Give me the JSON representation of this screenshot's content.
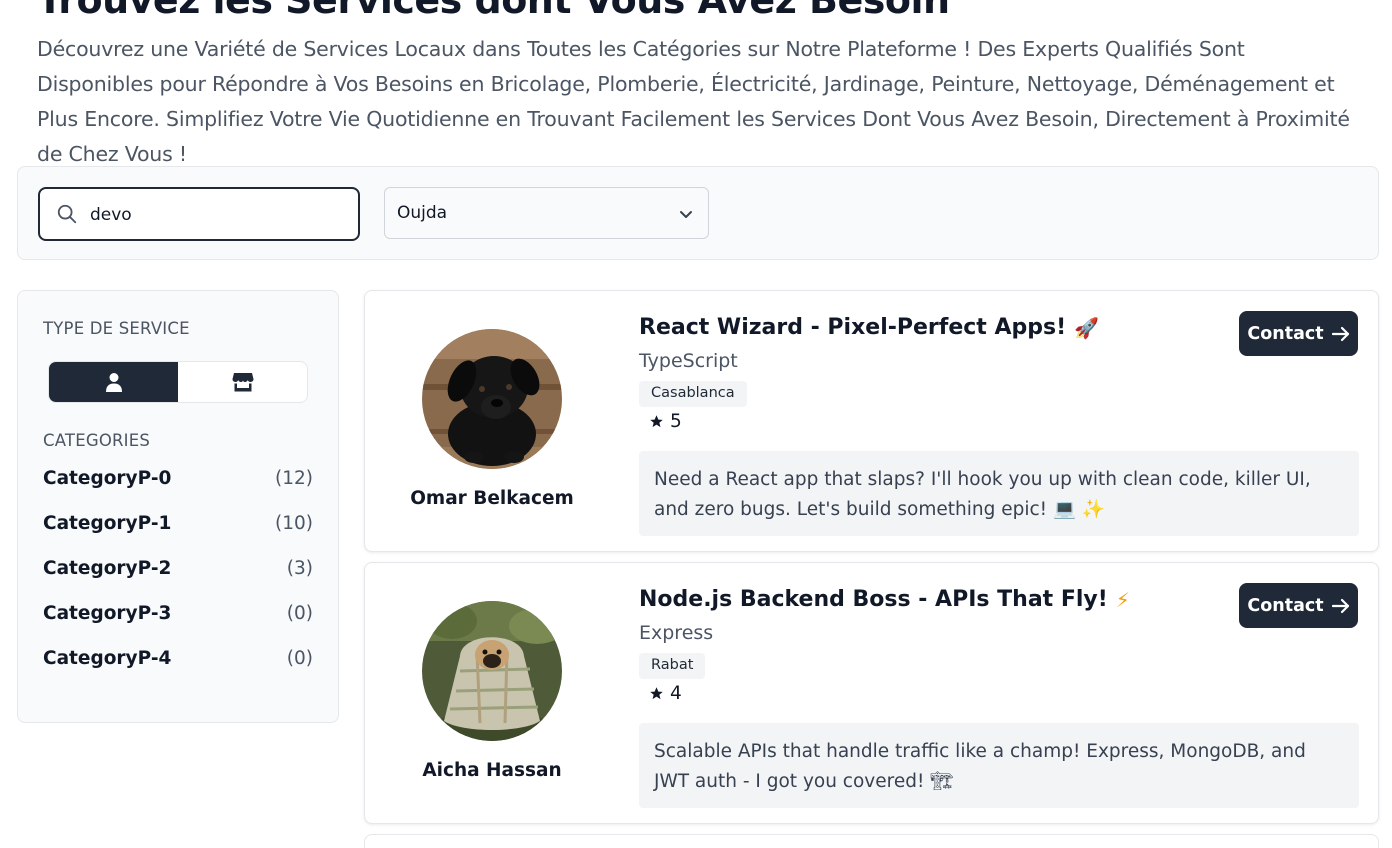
{
  "page": {
    "title": "Trouvez les Services dont Vous Avez Besoin",
    "intro": "Découvrez une Variété de Services Locaux dans Toutes les Catégories sur Notre Plateforme ! Des Experts Qualifiés Sont Disponibles pour Répondre à Vos Besoins en Bricolage, Plomberie, Électricité, Jardinage, Peinture, Nettoyage, Déménagement et Plus Encore. Simplifiez Votre Vie Quotidienne en Trouvant Facilement les Services Dont Vous Avez Besoin, Directement à Proximité de Chez Vous !"
  },
  "search": {
    "value": "devo",
    "icon": "search-icon",
    "city_selected": "Oujda"
  },
  "sidebar": {
    "type_heading": "TYPE DE SERVICE",
    "type_options": [
      {
        "icon": "person-icon",
        "active": true
      },
      {
        "icon": "store-icon",
        "active": false
      }
    ],
    "categories_heading": "CATEGORIES",
    "categories": [
      {
        "name": "CategoryP-0",
        "count": "(12)"
      },
      {
        "name": "CategoryP-1",
        "count": "(10)"
      },
      {
        "name": "CategoryP-2",
        "count": "(3)"
      },
      {
        "name": "CategoryP-3",
        "count": "(0)"
      },
      {
        "name": "CategoryP-4",
        "count": "(0)"
      }
    ]
  },
  "services": [
    {
      "title": "React Wizard - Pixel-Perfect Apps!",
      "emoji": "🚀",
      "subtitle": "TypeScript",
      "city": "Casablanca",
      "rating": "5",
      "description": "Need a React app that slaps? I'll hook you up with clean code, killer UI, and zero bugs. Let's build something epic! 💻 ✨",
      "provider": "Omar Belkacem",
      "contact_label": "Contact"
    },
    {
      "title": "Node.js Backend Boss - APIs That Fly!",
      "emoji": "⚡",
      "subtitle": "Express",
      "city": "Rabat",
      "rating": "4",
      "description": "Scalable APIs that handle traffic like a champ! Express, MongoDB, and JWT auth - I got you covered! 🏗",
      "provider": "Aicha Hassan",
      "contact_label": "Contact"
    }
  ],
  "colors": {
    "primary": "#1f2937",
    "muted_bg": "#f3f4f6",
    "panel_bg": "#f9fafb",
    "border": "#e5e7eb"
  }
}
